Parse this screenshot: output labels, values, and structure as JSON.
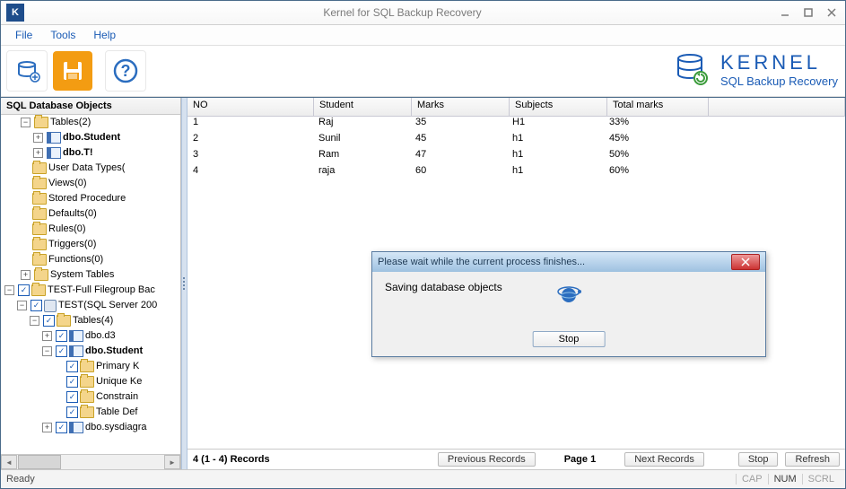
{
  "window": {
    "title": "Kernel for SQL Backup Recovery"
  },
  "menu": {
    "file": "File",
    "tools": "Tools",
    "help": "Help"
  },
  "brand": {
    "line1": "KERNEL",
    "line2": "SQL Backup Recovery"
  },
  "tree": {
    "title": "SQL Database Objects",
    "nodes": {
      "tables2": "Tables(2)",
      "student": "dbo.Student",
      "t1": "dbo.T!",
      "udt": "User Data Types(",
      "views": "Views(0)",
      "sp": "Stored Procedure",
      "defaults": "Defaults(0)",
      "rules": "Rules(0)",
      "triggers": "Triggers(0)",
      "functions": "Functions(0)",
      "systables": "System Tables",
      "testFull": "TEST-Full Filegroup Bac",
      "testServer": "TEST(SQL Server 200",
      "tables4": "Tables(4)",
      "d3": "dbo.d3",
      "student2": "dbo.Student",
      "pk": "Primary K",
      "uk": "Unique Ke",
      "cons": "Constrain",
      "tdef": "Table Def",
      "sysd": "dbo.sysdiagra"
    }
  },
  "grid": {
    "headers": {
      "no": "NO",
      "student": "Student",
      "marks": "Marks",
      "subjects": "Subjects",
      "total": "Total marks"
    },
    "rows": [
      {
        "no": "1",
        "student": "Raj",
        "marks": "35",
        "subjects": "H1",
        "total": "33%"
      },
      {
        "no": "2",
        "student": "Sunil",
        "marks": "45",
        "subjects": "h1",
        "total": "45%"
      },
      {
        "no": "3",
        "student": "Ram",
        "marks": "47",
        "subjects": "h1",
        "total": "50%"
      },
      {
        "no": "4",
        "student": "raja",
        "marks": "60",
        "subjects": "h1",
        "total": "60%"
      }
    ]
  },
  "footer": {
    "records": "4 (1 - 4) Records",
    "prev": "Previous Records",
    "page": "Page 1",
    "next": "Next Records",
    "stop": "Stop",
    "refresh": "Refresh"
  },
  "status": {
    "ready": "Ready",
    "cap": "CAP",
    "num": "NUM",
    "scrl": "SCRL"
  },
  "dialog": {
    "title": "Please wait while the current process finishes...",
    "msg": "Saving database objects",
    "stop": "Stop"
  }
}
